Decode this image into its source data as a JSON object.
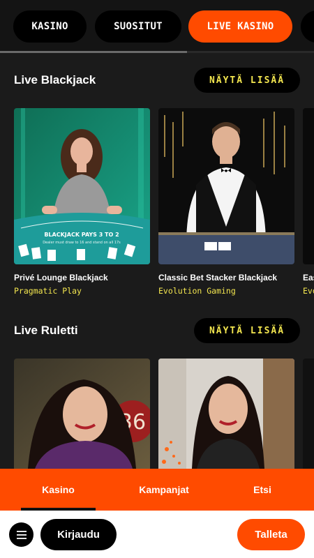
{
  "tabs": [
    {
      "label": "KASINO",
      "active": false
    },
    {
      "label": "SUOSITUT",
      "active": false
    },
    {
      "label": "LIVE KASINO",
      "active": true
    },
    {
      "label": "",
      "active": false
    }
  ],
  "sections": [
    {
      "title": "Live Blackjack",
      "more_label": "NÄYTÄ LISÄÄ",
      "games": [
        {
          "title": "Privé Lounge Blackjack",
          "provider": "Pragmatic Play"
        },
        {
          "title": "Classic Bet Stacker Blackjack",
          "provider": "Evolution Gaming"
        },
        {
          "title": "Eas",
          "provider": "Evo"
        }
      ]
    },
    {
      "title": "Live Ruletti",
      "more_label": "NÄYTÄ LISÄÄ",
      "games": [
        {
          "title": "",
          "provider": ""
        },
        {
          "title": "",
          "provider": ""
        },
        {
          "title": "",
          "provider": ""
        }
      ]
    }
  ],
  "card_art": {
    "blackjack_table_text": "BLACKJACK PAYS 3 TO 2",
    "blackjack_table_subtext": "Dealer must draw to 16 and stand on all 17s",
    "roulette_number": "36"
  },
  "bottom_nav": [
    {
      "label": "Kasino",
      "active": true
    },
    {
      "label": "Kampanjat",
      "active": false
    },
    {
      "label": "Etsi",
      "active": false
    }
  ],
  "actions": {
    "menu_icon": "hamburger-menu-icon",
    "login_label": "Kirjaudu",
    "deposit_label": "Talleta"
  },
  "colors": {
    "accent": "#ff4b00",
    "highlight": "#f3e64f",
    "background": "#1b1b1b"
  }
}
